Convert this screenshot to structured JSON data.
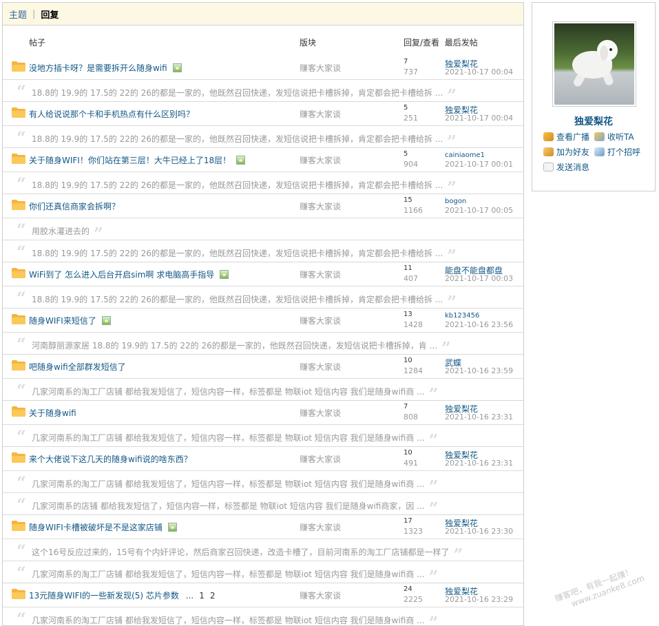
{
  "tabs": {
    "topics": "主题",
    "replies": "回复"
  },
  "columns": {
    "title": "帖子",
    "forum": "版块",
    "stats": "回复/查看",
    "last": "最后发帖"
  },
  "threads": [
    {
      "title": "没地方插卡呀？是需要拆开么随身wifi",
      "has_image": true,
      "forum": "赚客大家谈",
      "replies": "7",
      "views": "737",
      "last_user": "独爱梨花",
      "last_time": "2021-10-17 00:04",
      "quotes": [
        "18.8的 19.9的 17.5的 22的 26的都是一家的，他既然召回快递，发短信说把卡槽拆掉，肯定都会把卡槽给拆 ..."
      ]
    },
    {
      "title": "有人给说说那个卡和手机热点有什么区别吗？",
      "has_image": false,
      "forum": "赚客大家谈",
      "replies": "5",
      "views": "251",
      "last_user": "独爱梨花",
      "last_time": "2021-10-17 00:04",
      "quotes": [
        "18.8的 19.9的 17.5的 22的 26的都是一家的，他既然召回快递，发短信说把卡槽拆掉，肯定都会把卡槽给拆 ..."
      ]
    },
    {
      "title": "关于随身WIFI！你们站在第三层！大牛已经上了18层！",
      "has_image": true,
      "forum": "赚客大家谈",
      "replies": "5",
      "views": "904",
      "last_user": "cainiaome1",
      "last_time": "2021-10-17 00:01",
      "quotes": [
        "18.8的 19.9的 17.5的 22的 26的都是一家的，他既然召回快递，发短信说把卡槽拆掉，肯定都会把卡槽给拆 ..."
      ]
    },
    {
      "title": "你们还真信商家会拆啊？",
      "has_image": false,
      "forum": "赚客大家谈",
      "replies": "15",
      "views": "1166",
      "last_user": "bogon",
      "last_time": "2021-10-17 00:05",
      "quotes": [
        "用胶水灌进去的",
        "18.8的 19.9的 17.5的 22的 26的都是一家的，他既然召回快递，发短信说把卡槽拆掉，肯定都会把卡槽给拆 ..."
      ]
    },
    {
      "title": "WiFi到了 怎么进入后台开启sim啊 求电脑高手指导",
      "has_image": true,
      "forum": "赚客大家谈",
      "replies": "11",
      "views": "407",
      "last_user": "能盘不能盘都盘",
      "last_time": "2021-10-17 00:03",
      "quotes": [
        "18.8的 19.9的 17.5的 22的 26的都是一家的，他既然召回快递，发短信说把卡槽拆掉，肯定都会把卡槽给拆 ..."
      ]
    },
    {
      "title": "随身WIFI来短信了",
      "has_image": true,
      "forum": "赚客大家谈",
      "replies": "13",
      "views": "1428",
      "last_user": "kb123456",
      "last_time": "2021-10-16 23:56",
      "quotes": [
        "河南醇丽源家居 18.8的 19.9的 17.5的 22的 26的都是一家的，他既然召回快递，发短信说把卡槽拆掉，肯 ..."
      ]
    },
    {
      "title": "吧随身wifi全部群发短信了",
      "has_image": false,
      "forum": "赚客大家谈",
      "replies": "10",
      "views": "1284",
      "last_user": "武蝶",
      "last_time": "2021-10-16 23:59",
      "quotes": [
        "几家河南系的淘工厂店铺 都给我发短信了，短信内容一样，标签都是 物联iot 短信内容 我们是随身wifi商 ..."
      ]
    },
    {
      "title": "关于随身wifi",
      "has_image": false,
      "forum": "赚客大家谈",
      "replies": "7",
      "views": "808",
      "last_user": "独爱梨花",
      "last_time": "2021-10-16 23:31",
      "quotes": [
        "几家河南系的淘工厂店铺 都给我发短信了，短信内容一样，标签都是 物联iot 短信内容 我们是随身wifi商 ..."
      ]
    },
    {
      "title": "来个大佬说下这几天的随身wifi说的啥东西？",
      "has_image": false,
      "forum": "赚客大家谈",
      "replies": "10",
      "views": "491",
      "last_user": "独爱梨花",
      "last_time": "2021-10-16 23:31",
      "quotes": [
        "几家河南系的淘工厂店铺 都给我发短信了，短信内容一样，标签都是 物联iot 短信内容 我们是随身wifi商 ...",
        "几家河南系的店铺 都给我发短信了，短信内容一样，标签都是 物联iot 短信内容 我们是随身wifi商家，因 ..."
      ]
    },
    {
      "title": "随身WIFI卡槽被破坏是不是这家店铺",
      "has_image": true,
      "forum": "赚客大家谈",
      "replies": "17",
      "views": "1323",
      "last_user": "独爱梨花",
      "last_time": "2021-10-16 23:30",
      "quotes": [
        "这个16号反应过来的，15号有个内奸评论，然后商家召回快递，改造卡槽了，目前河南系的淘工厂店铺都是一样了",
        "几家河南系的淘工厂店铺 都给我发短信了，短信内容一样，标签都是 物联iot 短信内容 我们是随身wifi商 ..."
      ]
    },
    {
      "title": "13元随身WIFI的一些新发现(5) 芯片参数",
      "has_image": false,
      "pages": [
        "1",
        "2"
      ],
      "forum": "赚客大家谈",
      "replies": "24",
      "views": "2225",
      "last_user": "独爱梨花",
      "last_time": "2021-10-16 23:29",
      "quotes": [
        "几家河南系的淘工厂店铺 都给我发短信了，短信内容一样，标签都是 物联iot 短信内容 我们是随身wifi商 ..."
      ]
    }
  ],
  "profile": {
    "username": "独爱梨花",
    "actions": {
      "broadcast": "查看广播",
      "listen": "收听TA",
      "add_friend": "加为好友",
      "poke": "打个招呼",
      "message": "发送消息"
    }
  },
  "watermark": {
    "line1": "赚客吧，有我一起赚！",
    "line2": "www.zuanke8.com"
  },
  "colors": {
    "link": "#135785",
    "tab_bg": "#fdf8e4",
    "muted": "#999999"
  }
}
